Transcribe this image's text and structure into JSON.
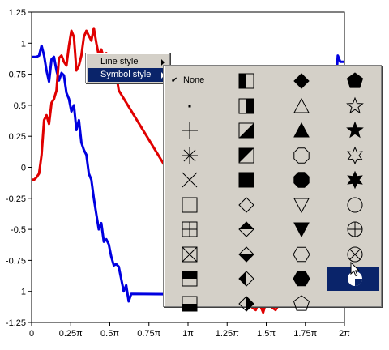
{
  "chart_data": {
    "type": "line",
    "x_tick_labels": [
      "0",
      "0.25π",
      "0.5π",
      "0.75π",
      "1π",
      "1.25π",
      "1.5π",
      "1.75π",
      "2π"
    ],
    "y_tick_labels": [
      "1.25",
      "1",
      "0.75",
      "0.5",
      "0.25",
      "0",
      "-0.25",
      "-0.5",
      "-0.75",
      "-1",
      "-1.25"
    ],
    "xlim": [
      0,
      6.2832
    ],
    "ylim": [
      -1.25,
      1.25
    ],
    "grid": false,
    "series": [
      {
        "color": "#0000e0",
        "points": [
          [
            0,
            0.89
          ],
          [
            0.05,
            0.89
          ],
          [
            0.1,
            0.89
          ],
          [
            0.15,
            0.9
          ],
          [
            0.2,
            0.98
          ],
          [
            0.25,
            0.9
          ],
          [
            0.3,
            0.78
          ],
          [
            0.35,
            0.69
          ],
          [
            0.4,
            0.87
          ],
          [
            0.45,
            0.89
          ],
          [
            0.5,
            0.78
          ],
          [
            0.55,
            0.7
          ],
          [
            0.6,
            0.76
          ],
          [
            0.65,
            0.74
          ],
          [
            0.7,
            0.6
          ],
          [
            0.75,
            0.55
          ],
          [
            0.8,
            0.45
          ],
          [
            0.85,
            0.5
          ],
          [
            0.9,
            0.3
          ],
          [
            0.95,
            0.38
          ],
          [
            1.0,
            0.2
          ],
          [
            1.05,
            0.14
          ],
          [
            1.1,
            0.1
          ],
          [
            1.15,
            -0.05
          ],
          [
            1.2,
            -0.1
          ],
          [
            1.25,
            -0.25
          ],
          [
            1.3,
            -0.38
          ],
          [
            1.35,
            -0.5
          ],
          [
            1.4,
            -0.45
          ],
          [
            1.45,
            -0.6
          ],
          [
            1.5,
            -0.58
          ],
          [
            1.55,
            -0.62
          ],
          [
            1.6,
            -0.72
          ],
          [
            1.65,
            -0.79
          ],
          [
            1.7,
            -0.78
          ],
          [
            1.75,
            -0.8
          ],
          [
            1.8,
            -0.9
          ],
          [
            1.85,
            -1.0
          ],
          [
            1.9,
            -0.95
          ],
          [
            1.95,
            -1.08
          ],
          [
            2.0,
            -1.02
          ],
          [
            5.0,
            -1.03
          ],
          [
            5.1,
            -0.95
          ],
          [
            5.5,
            -0.65
          ],
          [
            5.7,
            -0.35
          ],
          [
            5.85,
            -0.05
          ],
          [
            6.0,
            0.3
          ],
          [
            6.1,
            0.6
          ],
          [
            6.15,
            0.9
          ],
          [
            6.2,
            0.85
          ],
          [
            6.2832,
            0.85
          ]
        ]
      },
      {
        "color": "#e00000",
        "points": [
          [
            0,
            -0.1
          ],
          [
            0.05,
            -0.1
          ],
          [
            0.1,
            -0.08
          ],
          [
            0.15,
            -0.05
          ],
          [
            0.2,
            0.1
          ],
          [
            0.25,
            0.38
          ],
          [
            0.3,
            0.42
          ],
          [
            0.35,
            0.35
          ],
          [
            0.4,
            0.52
          ],
          [
            0.45,
            0.55
          ],
          [
            0.5,
            0.62
          ],
          [
            0.55,
            0.88
          ],
          [
            0.6,
            0.9
          ],
          [
            0.65,
            0.85
          ],
          [
            0.7,
            0.82
          ],
          [
            0.75,
            0.98
          ],
          [
            0.8,
            1.1
          ],
          [
            0.85,
            1.05
          ],
          [
            0.9,
            0.78
          ],
          [
            0.95,
            0.82
          ],
          [
            1.0,
            0.9
          ],
          [
            1.05,
            1.05
          ],
          [
            1.1,
            1.1
          ],
          [
            1.15,
            1.06
          ],
          [
            1.2,
            1.02
          ],
          [
            1.25,
            1.12
          ],
          [
            1.3,
            1.0
          ],
          [
            1.35,
            0.9
          ],
          [
            1.4,
            0.95
          ],
          [
            1.45,
            0.88
          ],
          [
            1.5,
            0.92
          ],
          [
            1.55,
            0.85
          ],
          [
            1.6,
            0.8
          ],
          [
            1.65,
            0.72
          ],
          [
            1.7,
            0.75
          ],
          [
            1.75,
            0.62
          ],
          [
            4.4,
            -1.12
          ],
          [
            4.5,
            -1.15
          ],
          [
            4.55,
            -1.1
          ],
          [
            4.6,
            -1.12
          ],
          [
            4.65,
            -1.17
          ],
          [
            4.7,
            -1.1
          ],
          [
            4.8,
            -1.12
          ],
          [
            4.9,
            -1.15
          ],
          [
            5.0,
            -1.08
          ]
        ]
      }
    ]
  },
  "context_menu": {
    "items": [
      {
        "label": "Line style"
      },
      {
        "label": "Symbol style"
      }
    ]
  },
  "symbol_menu": {
    "none_label": "None",
    "check_glyph": "✔",
    "symbols": [
      "none",
      "half-square-left",
      "diamond-filled",
      "pentagon-filled",
      "dot",
      "half-square-right",
      "triangle-open",
      "star5-open",
      "plus",
      "half-square-diag-lower",
      "triangle-filled",
      "star5-filled",
      "asterisk",
      "half-square-diag-upper",
      "octagon-open",
      "star6-open",
      "cross",
      "square-filled",
      "octagon-filled",
      "star6-filled",
      "square-open",
      "diamond-open",
      "triangle-down-open",
      "circle-open",
      "square-plus",
      "diamond-half-top",
      "triangle-down-filled",
      "circle-plus",
      "square-x",
      "diamond-half-bottom",
      "hexagon-open",
      "circle-x",
      "square-half-top",
      "diamond-half-left",
      "hexagon-filled",
      "circle-pie",
      "square-half-bottom",
      "diamond-half-right",
      "pentagon-open",
      ""
    ],
    "selected_index": 35
  },
  "cursor": "arrow-cursor-icon"
}
